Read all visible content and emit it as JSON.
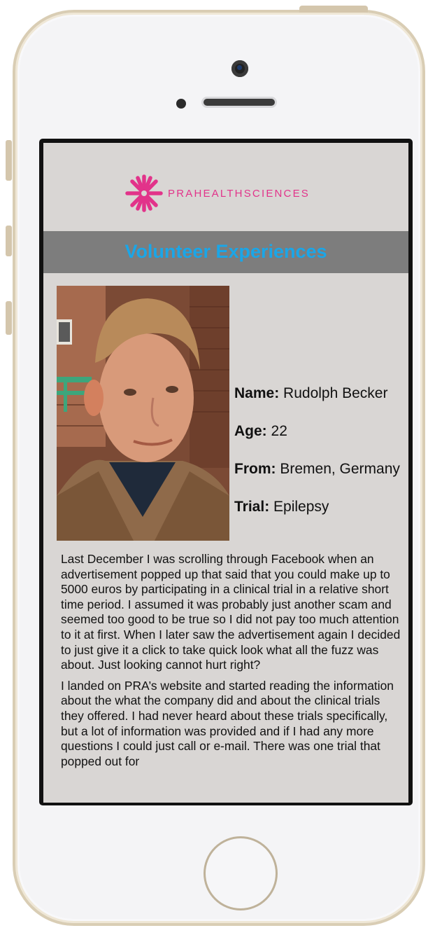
{
  "brand": {
    "logo_text": "PRAHEALTHSCIENCES",
    "logo_color": "#e2338a"
  },
  "page": {
    "title": "Volunteer Experiences",
    "title_color": "#1aa6e8",
    "banner_color": "#7d7d7d"
  },
  "profile": {
    "name_label": "Name:",
    "name_value": "Rudolph Becker",
    "age_label": "Age:",
    "age_value": "22",
    "from_label": "From:",
    "from_value": "Bremen, Germany",
    "trial_label": "Trial:",
    "trial_value": "Epilepsy"
  },
  "story": {
    "paragraph_1": "Last December I was scrolling through Facebook when an advertisement popped up that said that you could make up to 5000 euros by participating in a clinical trial in a relative short time period. I assumed it was probably just another scam and seemed too good to be true so I did not pay too much attention to it at first. When I later saw the advertisement again I decided to just give it a click to take quick look what all the fuzz was about. Just looking cannot hurt right?",
    "paragraph_2": "I landed on PRA’s website and started reading the information about the what the company did and about the clinical trials they offered. I had never heard about these trials specifically, but a lot of information was provided and if I had any more questions I could just call or e-mail. There was one trial that popped out for"
  }
}
